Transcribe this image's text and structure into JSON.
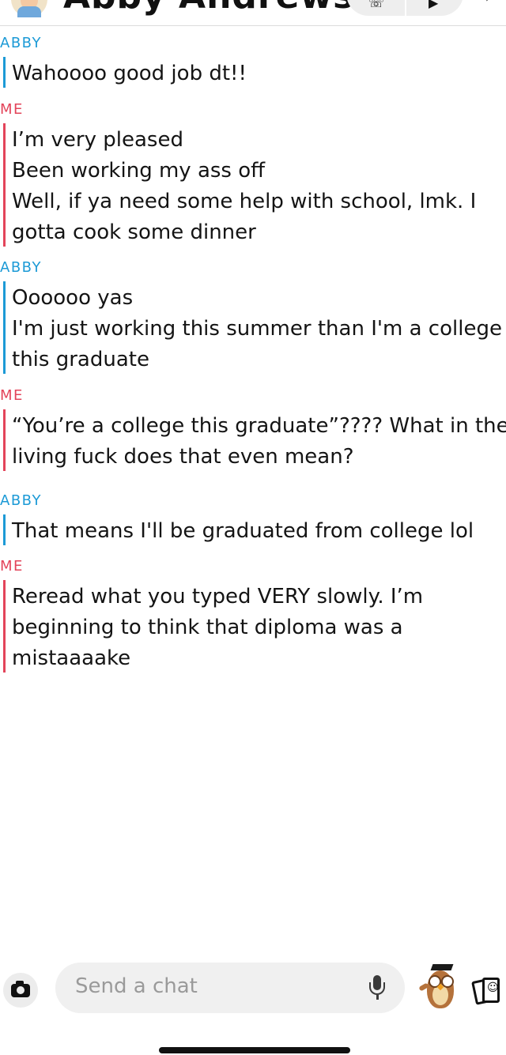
{
  "header": {
    "contact_name": "Abby Andrews",
    "avatar_icon": "bitmoji-avatar-icon",
    "heart_icon": "red-heart-emoji-icon",
    "call_icons": [
      "phone-icon",
      "video-icon"
    ],
    "more_icon": "chevron-right-icon"
  },
  "messages": [
    {
      "sender": "ABBY",
      "lines": [
        "Wahoooo good job dt!!"
      ]
    },
    {
      "sender": "ME",
      "lines": [
        "I’m very pleased",
        "Been working my ass off",
        "Well, if ya need some help with school, lmk. I",
        "gotta cook some dinner"
      ]
    },
    {
      "sender": "ABBY",
      "lines": [
        "Oooooo yas",
        "I'm just working this summer than I'm a college",
        "this graduate"
      ]
    },
    {
      "sender": "ME",
      "lines": [
        "“You’re a college this graduate”???? What in the",
        "living fuck does that even mean?"
      ]
    },
    {
      "sender": "ABBY",
      "lines": [
        "That means I'll be graduated from college lol"
      ]
    },
    {
      "sender": "ME",
      "lines": [
        "Reread what you typed VERY slowly. I’m",
        "beginning to think that diploma was a",
        "mistaaaake"
      ]
    }
  ],
  "composer": {
    "camera_icon": "camera-icon",
    "placeholder": "Send a chat",
    "mic_icon": "microphone-icon",
    "bitmoji_icon": "graduate-owl-bitmoji-icon",
    "cards_icon": "cards-icon"
  },
  "colors": {
    "abby": "#1c9ad6",
    "me": "#e3445a"
  }
}
